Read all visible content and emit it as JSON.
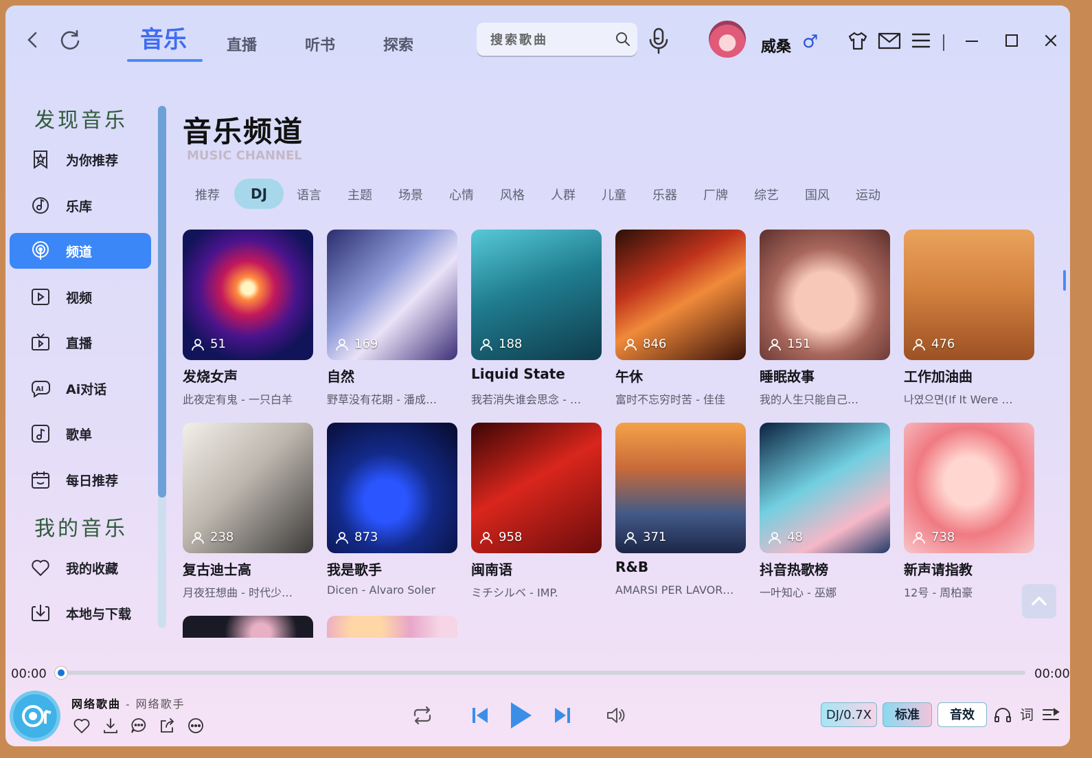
{
  "header": {
    "tabs": [
      {
        "label": "音乐",
        "active": true
      },
      {
        "label": "直播"
      },
      {
        "label": "听书"
      },
      {
        "label": "探索"
      }
    ],
    "search_placeholder": "搜索歌曲",
    "username": "威桑",
    "gender_symbol": "♂",
    "icons": [
      "back-icon",
      "refresh-icon",
      "search-icon",
      "microphone-icon",
      "shirt-icon",
      "mail-icon",
      "menu-icon",
      "minimize-icon",
      "maximize-icon",
      "close-icon"
    ]
  },
  "sidebar": {
    "sections": [
      {
        "title": "发现音乐",
        "items": [
          {
            "label": "为你推荐",
            "icon": "star-bookmark-icon"
          },
          {
            "label": "乐库",
            "icon": "music-disc-icon"
          },
          {
            "label": "频道",
            "icon": "broadcast-icon",
            "active": true
          },
          {
            "label": "视频",
            "icon": "video-icon"
          },
          {
            "label": "直播",
            "icon": "tv-icon"
          },
          {
            "label": "Ai对话",
            "icon": "ai-chat-icon"
          },
          {
            "label": "歌单",
            "icon": "playlist-icon"
          },
          {
            "label": "每日推荐",
            "icon": "calendar-icon"
          }
        ]
      },
      {
        "title": "我的音乐",
        "items": [
          {
            "label": "我的收藏",
            "icon": "heart-icon"
          },
          {
            "label": "本地与下载",
            "icon": "download-icon"
          }
        ]
      }
    ]
  },
  "main": {
    "title": "音乐频道",
    "subtitle": "MUSIC CHANNEL",
    "categories": [
      "推荐",
      "DJ",
      "语言",
      "主题",
      "场景",
      "心情",
      "风格",
      "人群",
      "儿童",
      "乐器",
      "厂牌",
      "综艺",
      "国风",
      "运动"
    ],
    "active_category": "DJ",
    "cards": [
      {
        "title": "发烧女声",
        "subtitle": "此夜定有鬼 - 一只白羊",
        "plays": "51"
      },
      {
        "title": "自然",
        "subtitle": "野草没有花期 - 潘成…",
        "plays": "169"
      },
      {
        "title": "Liquid State",
        "subtitle": "我若消失谁会思念 - …",
        "plays": "188"
      },
      {
        "title": "午休",
        "subtitle": "富时不忘穷时苦 - 佳佳",
        "plays": "846"
      },
      {
        "title": "睡眠故事",
        "subtitle": "我的人生只能自己…",
        "plays": "151"
      },
      {
        "title": "工作加油曲",
        "subtitle": "나였으면(If It Were …",
        "plays": "476"
      },
      {
        "title": "复古迪士高",
        "subtitle": "月夜狂想曲 - 时代少…",
        "plays": "238"
      },
      {
        "title": "我是歌手",
        "subtitle": "Dicen - Alvaro Soler",
        "plays": "873"
      },
      {
        "title": "闽南语",
        "subtitle": "ミチシルベ - IMP.",
        "plays": "958"
      },
      {
        "title": "R&B",
        "subtitle": "AMARSI PER LAVOR…",
        "plays": "371"
      },
      {
        "title": "抖音热歌榜",
        "subtitle": "一叶知心 - 巫娜",
        "plays": "48"
      },
      {
        "title": "新声请指教",
        "subtitle": "12号 - 周柏豪",
        "plays": "738"
      }
    ]
  },
  "player": {
    "current_time": "00:00",
    "total_time": "00:00",
    "progress": 0,
    "song": "网络歌曲",
    "separator": " - ",
    "artist": "网络歌手",
    "speed_label": "DJ/0.7X",
    "quality_label": "标准",
    "effect_label": "音效",
    "lyrics_label": "词",
    "accent_color": "#3b8ee8"
  }
}
